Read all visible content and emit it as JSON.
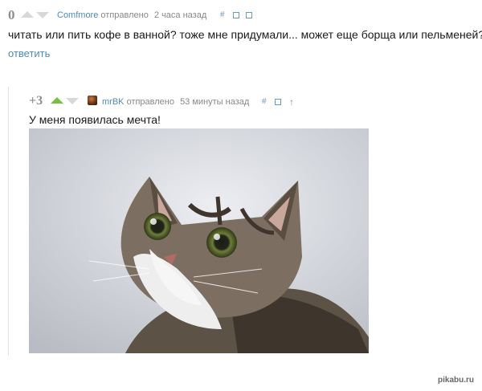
{
  "comment1": {
    "rating": "0",
    "author": "Comfmore",
    "posted_label": "отправлено",
    "time": "2 часа назад",
    "link_icon": "#",
    "text": "читать или пить кофе в ванной? тоже мне придумали... может еще борща или пельменей?",
    "reply_label": "ответить"
  },
  "comment2": {
    "rating": "+3",
    "author": "mrBK",
    "posted_label": "отправлено",
    "time": "53 минуты назад",
    "link_icon": "#",
    "up_icon": "↑",
    "text": "У меня появилась мечта!"
  },
  "watermark": "pikabu.ru",
  "colors": {
    "accent": "#4f8ab8",
    "upvoted": "#78c13a",
    "arrow": "#d8d8d8"
  }
}
